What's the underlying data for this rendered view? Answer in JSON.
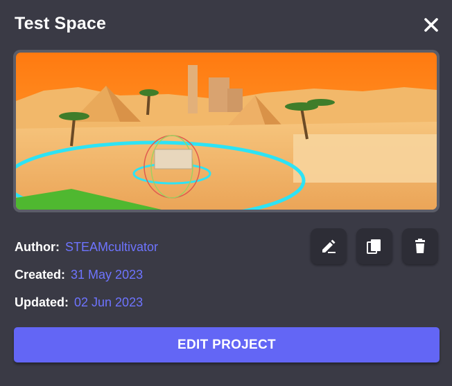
{
  "dialog": {
    "title": "Test Space",
    "close_icon": "close-icon"
  },
  "thumbnail": {
    "description_icon": "desert-scene-image",
    "sky_color": "#ff8a1a",
    "ground_color": "#f3b567",
    "ring_color": "#2de3f5"
  },
  "meta": {
    "author_label": "Author:",
    "author_value": "STEAMcultivator",
    "created_label": "Created:",
    "created_value": "31 May 2023",
    "updated_label": "Updated:",
    "updated_value": "02 Jun 2023"
  },
  "actions": {
    "rename_icon": "pencil-icon",
    "duplicate_icon": "copy-icon",
    "delete_icon": "trash-icon",
    "edit_label": "EDIT PROJECT"
  },
  "colors": {
    "accent": "#6366f5",
    "link": "#6e74ff",
    "background": "#3a3a45"
  }
}
